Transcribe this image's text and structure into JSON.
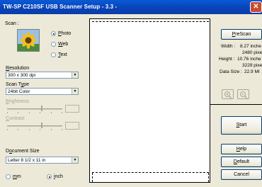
{
  "window": {
    "title": "TW-SP C210SF USB Scanner Setup - 3.3 -"
  },
  "scan": {
    "label": "Scan :",
    "options": [
      {
        "key": "P",
        "rest": "hoto",
        "selected": true
      },
      {
        "key": "W",
        "rest": "eb",
        "selected": false
      },
      {
        "key": "T",
        "rest": "ext",
        "selected": false
      }
    ]
  },
  "resolution": {
    "key": "R",
    "rest": "esolution",
    "value": "300 x 300 dpi"
  },
  "scan_type": {
    "pre": "Scan T",
    "key": "y",
    "rest": "pe",
    "value": "24bit Color"
  },
  "brightness": {
    "key": "B",
    "rest": "rightness",
    "enabled": false
  },
  "contrast": {
    "key": "C",
    "rest": "ontrast",
    "enabled": false
  },
  "document_size": {
    "pre": "D",
    "key": "o",
    "rest": "cument Size",
    "value": "Letter 8 1/2 x 11 in"
  },
  "units": [
    {
      "key": "m",
      "rest": "m",
      "selected": false
    },
    {
      "key": "i",
      "rest": "nch",
      "selected": true
    }
  ],
  "buttons": {
    "prescan": {
      "pre": "",
      "key": "P",
      "rest": "reScan"
    },
    "start": {
      "pre": "",
      "key": "S",
      "rest": "tart"
    },
    "help": {
      "pre": "",
      "key": "H",
      "rest": "elp"
    },
    "default": {
      "pre": "",
      "key": "D",
      "rest": "efault"
    },
    "cancel": {
      "label": "Cancel"
    }
  },
  "info": {
    "width_label": "Width :",
    "width_in": "8.27 inche",
    "width_px": "2480 pixel",
    "height_label": "Height :",
    "height_in": "10.76 inche",
    "height_px": "3229 pixel",
    "size_label": "Data Size :",
    "size_val": "22.9 MI"
  },
  "icons": {
    "zoom_in": "zoom-in-icon",
    "zoom_out": "zoom-out-icon"
  },
  "colors": {
    "title_bar": "#0843b8",
    "face": "#ece9d8",
    "close": "#c94b2f"
  }
}
